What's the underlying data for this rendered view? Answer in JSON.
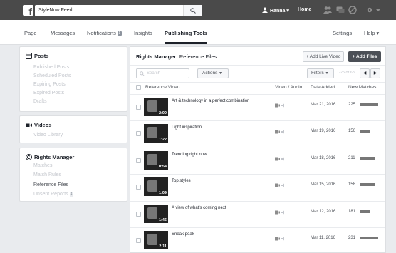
{
  "header": {
    "logo": "f",
    "search_value": "StyleNow Feed",
    "user_name": "Hanna",
    "user_caret": "▾",
    "home_label": "Home"
  },
  "nav": {
    "tabs": [
      "Page",
      "Messages",
      "Notifications",
      "Insights",
      "Publishing Tools"
    ],
    "notifications_badge": "1",
    "settings": "Settings",
    "help": "Help ▾"
  },
  "sidebar": {
    "posts": {
      "title": "Posts",
      "items": [
        "Published Posts",
        "Scheduled Posts",
        "Expiring Posts",
        "Expired Posts",
        "Drafts"
      ]
    },
    "videos": {
      "title": "Videos",
      "items": [
        "Video Library"
      ]
    },
    "rights": {
      "title": "Rights Manager",
      "items": [
        "Matches",
        "Match Rules",
        "Reference Files",
        "Unsent Reports"
      ],
      "unsent_badge": "4"
    }
  },
  "main": {
    "title_bold": "Rights Manager:",
    "title_rest": " Reference Files",
    "add_live_video": "+ Add Live Video",
    "add_files": "+ Add Files",
    "search_placeholder": "Search",
    "actions_label": "Actions",
    "filters_label": "Filters",
    "count_label": "1-25 of 68",
    "pager_prev": "◀",
    "pager_next": "▶",
    "columns": [
      "Reference Video",
      "Video / Audio",
      "Date Added",
      "New Matches"
    ],
    "rows": [
      {
        "title": "Art & technology in a perfect combination",
        "duration": "2:00",
        "date": "Mar 21, 2016",
        "matches": "225",
        "match_level": 1.0
      },
      {
        "title": "Light inspiration",
        "duration": "1:22",
        "date": "Mar 19, 2016",
        "matches": "156",
        "match_level": 0.55
      },
      {
        "title": "Trending right now",
        "duration": "0:54",
        "date": "Mar 18, 2016",
        "matches": "211",
        "match_level": 0.85
      },
      {
        "title": "Top styles",
        "duration": "1:09",
        "date": "Mar 15, 2016",
        "matches": "158",
        "match_level": 0.8
      },
      {
        "title": "A view of what's coming next",
        "duration": "1:46",
        "date": "Mar 12, 2016",
        "matches": "181",
        "match_level": 0.55
      },
      {
        "title": "Sneak peak",
        "duration": "2:11",
        "date": "Mar 11, 2016",
        "matches": "231",
        "match_level": 1.0
      }
    ]
  },
  "colors": {
    "topbar": "#4a4a4a",
    "bar": "#777777",
    "primary_button": "#4b4f56"
  }
}
